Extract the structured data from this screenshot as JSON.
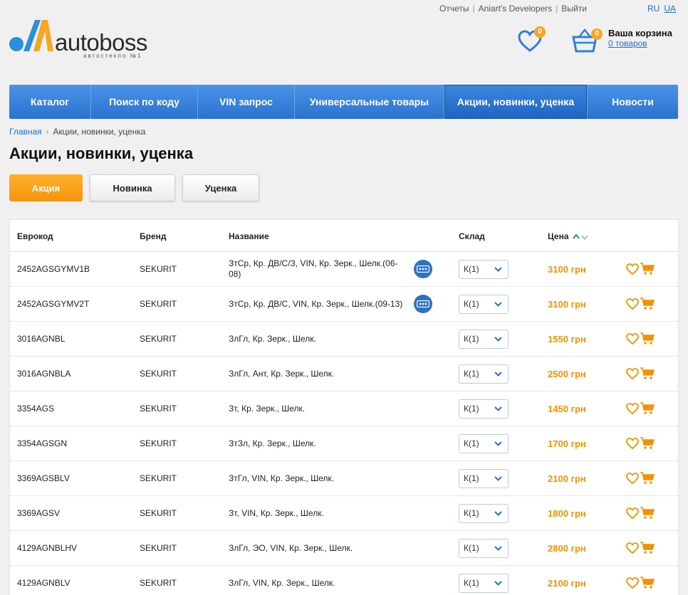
{
  "toplinks": {
    "reports": "Отчеты",
    "developers": "Aniart's Developers",
    "logout": "Выйти",
    "sep": "|"
  },
  "langs": {
    "ru": "RU",
    "ua": "UA"
  },
  "logo": {
    "word": "autoboss",
    "tagline": "автостекло №1"
  },
  "wishlist": {
    "count": "0"
  },
  "cart": {
    "count_badge": "0",
    "title": "Ваша корзина",
    "count_text": "0 товаров"
  },
  "nav": [
    {
      "label": "Каталог"
    },
    {
      "label": "Поиск по коду"
    },
    {
      "label": "VIN запрос"
    },
    {
      "label": "Универсальные товары"
    },
    {
      "label": "Акции, новинки, уценка"
    },
    {
      "label": "Новости"
    }
  ],
  "breadcrumb": {
    "home": "Главная",
    "chev": "›",
    "current": "Акции, новинки, уценка"
  },
  "page_title": "Акции, новинки, уценка",
  "filter_tabs": [
    {
      "label": "Акция"
    },
    {
      "label": "Новинка"
    },
    {
      "label": "Уценка"
    }
  ],
  "colors": {
    "accent": "#f39200",
    "nav": "#3a84dc",
    "link": "#1f6fc5"
  },
  "table": {
    "headers": {
      "code": "Еврокод",
      "brand": "Бренд",
      "name": "Название",
      "stock": "Склад",
      "price": "Цена"
    },
    "rows": [
      {
        "code": "2452AGSGYMV1B",
        "brand": "SEKURIT",
        "name": "ЗтСр, Кр. ДВ/С/З, VIN, Кр. Зерк., Шелк.(06-08)",
        "stock": "К(1)",
        "price": "3100 грн"
      },
      {
        "code": "2452AGSGYMV2T",
        "brand": "SEKURIT",
        "name": "ЗтСр, Кр. ДВ/С, VIN, Кр. Зерк., Шелк.(09-13)",
        "stock": "К(1)",
        "price": "3100 грн"
      },
      {
        "code": "3016AGNBL",
        "brand": "SEKURIT",
        "name": "ЗлГл, Кр. Зерк., Шелк.",
        "stock": "К(1)",
        "price": "1550 грн"
      },
      {
        "code": "3016AGNBLA",
        "brand": "SEKURIT",
        "name": "ЗлГл, Ант, Кр. Зерк., Шелк.",
        "stock": "К(1)",
        "price": "2500 грн"
      },
      {
        "code": "3354AGS",
        "brand": "SEKURIT",
        "name": "Зт, Кр. Зерк., Шелк.",
        "stock": "К(1)",
        "price": "1450 грн"
      },
      {
        "code": "3354AGSGN",
        "brand": "SEKURIT",
        "name": "ЗтЗл, Кр. Зерк., Шелк.",
        "stock": "К(1)",
        "price": "1700 грн"
      },
      {
        "code": "3369AGSBLV",
        "brand": "SEKURIT",
        "name": "ЗтГл, VIN, Кр. Зерк., Шелк.",
        "stock": "К(1)",
        "price": "2100 грн"
      },
      {
        "code": "3369AGSV",
        "brand": "SEKURIT",
        "name": "Зт, VIN, Кр. Зерк., Шелк.",
        "stock": "К(1)",
        "price": "1800 грн"
      },
      {
        "code": "4129AGNBLHV",
        "brand": "SEKURIT",
        "name": "ЗлГл, ЭО, VIN, Кр. Зерк., Шелк.",
        "stock": "К(1)",
        "price": "2800 грн"
      },
      {
        "code": "4129AGNBLV",
        "brand": "SEKURIT",
        "name": "ЗлГл, VIN, Кр. Зерк., Шелк.",
        "stock": "К(1)",
        "price": "2100 грн"
      }
    ]
  }
}
